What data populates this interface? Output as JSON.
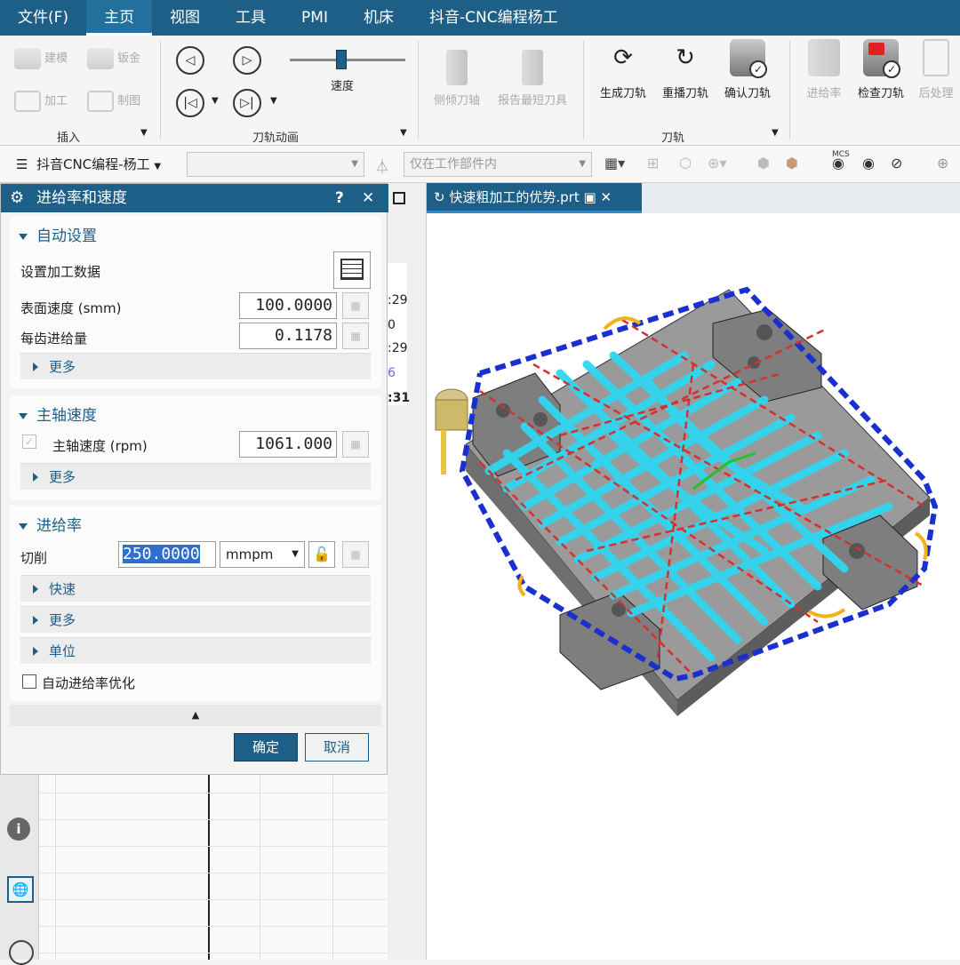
{
  "menubar": {
    "items": [
      "文件(F)",
      "主页",
      "视图",
      "工具",
      "PMI",
      "机床",
      "抖音-CNC编程杨工"
    ],
    "active_index": 1
  },
  "ribbon": {
    "insert_group": {
      "label": "插入",
      "buttons": [
        "建模",
        "钣金",
        "加工",
        "制图"
      ]
    },
    "animation_group": {
      "label": "刀轨动画",
      "speed_label": "速度"
    },
    "mid_buttons": [
      "侧倾刀轴",
      "报告最短刀具"
    ],
    "toolpath_group": {
      "label": "刀轨",
      "buttons": [
        "生成刀轨",
        "重播刀轨",
        "确认刀轨"
      ]
    },
    "right_buttons": [
      "进给率",
      "检查刀轨",
      "后处理"
    ]
  },
  "toolbar2": {
    "menu_label": "抖音CNC编程-杨工",
    "filter_placeholder": "仅在工作部件内",
    "mcs_label": "MCS"
  },
  "dialog": {
    "title": "进给率和速度",
    "help": "?",
    "close": "✕",
    "sections": {
      "auto": {
        "title": "自动设置",
        "set_data_label": "设置加工数据",
        "surface_speed_label": "表面速度 (smm)",
        "surface_speed_value": "100.0000",
        "feed_per_tooth_label": "每齿进给量",
        "feed_per_tooth_value": "0.1178",
        "more": "更多"
      },
      "spindle": {
        "title": "主轴速度",
        "spindle_label": "主轴速度 (rpm)",
        "spindle_value": "1061.000",
        "more": "更多"
      },
      "feed": {
        "title": "进给率",
        "cut_label": "切削",
        "cut_value": "250.0000",
        "unit": "mmpm",
        "rapid": "快速",
        "more": "更多",
        "units": "单位",
        "auto_opt_label": "自动进给率优化"
      }
    },
    "ok": "确定",
    "cancel": "取消"
  },
  "bg_partial": [
    ":29",
    "0",
    ":29",
    "6",
    ":31"
  ],
  "viewport": {
    "tab_title": "快速粗加工的优势.prt"
  },
  "colors": {
    "brand": "#1d5f86",
    "toolpath_cyan": "#2fd6f0",
    "toolpath_blue": "#1a2fd0",
    "toolpath_red": "#d43030",
    "part_gray": "#8c8c8c"
  }
}
